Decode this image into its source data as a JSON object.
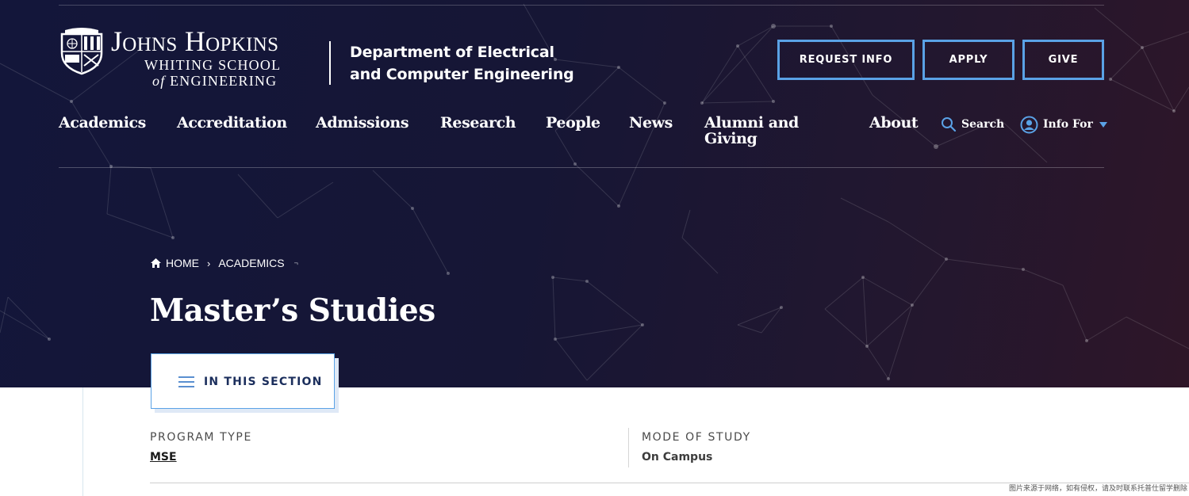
{
  "brand": {
    "line1": "Johns Hopkins",
    "line2": "WHITING SCHOOL",
    "line3_prefix": "of",
    "line3_suffix": "ENGINEERING",
    "department": "Department of Electrical and Computer Engineering"
  },
  "cta": {
    "request_info": "REQUEST INFO",
    "apply": "APPLY",
    "give": "GIVE"
  },
  "nav": {
    "items": [
      "Academics",
      "Accreditation",
      "Admissions",
      "Research",
      "People",
      "News",
      "Alumni and Giving",
      "About"
    ],
    "search": "Search",
    "info_for": "Info For"
  },
  "breadcrumb": {
    "home": "HOME",
    "academics": "ACADEMICS"
  },
  "page": {
    "title": "Master’s Studies",
    "section_menu": "IN THIS SECTION"
  },
  "program": {
    "type_label": "PROGRAM TYPE",
    "type_value": "MSE",
    "mode_label": "MODE OF STUDY",
    "mode_value": "On Campus"
  },
  "watermark": "图片来源于网络，如有侵权，请及时联系托普仕留学删除",
  "colors": {
    "hero_start": "#13163a",
    "hero_end": "#2e1628",
    "accent_blue": "#5aa2e6",
    "section_text": "#1b2e5c"
  },
  "icons": {
    "logo": "jhu-shield-icon",
    "search": "search-icon",
    "info_for": "user-circle-icon",
    "home": "home-icon",
    "menu": "hamburger-menu-icon",
    "dropdown": "caret-down-icon"
  }
}
